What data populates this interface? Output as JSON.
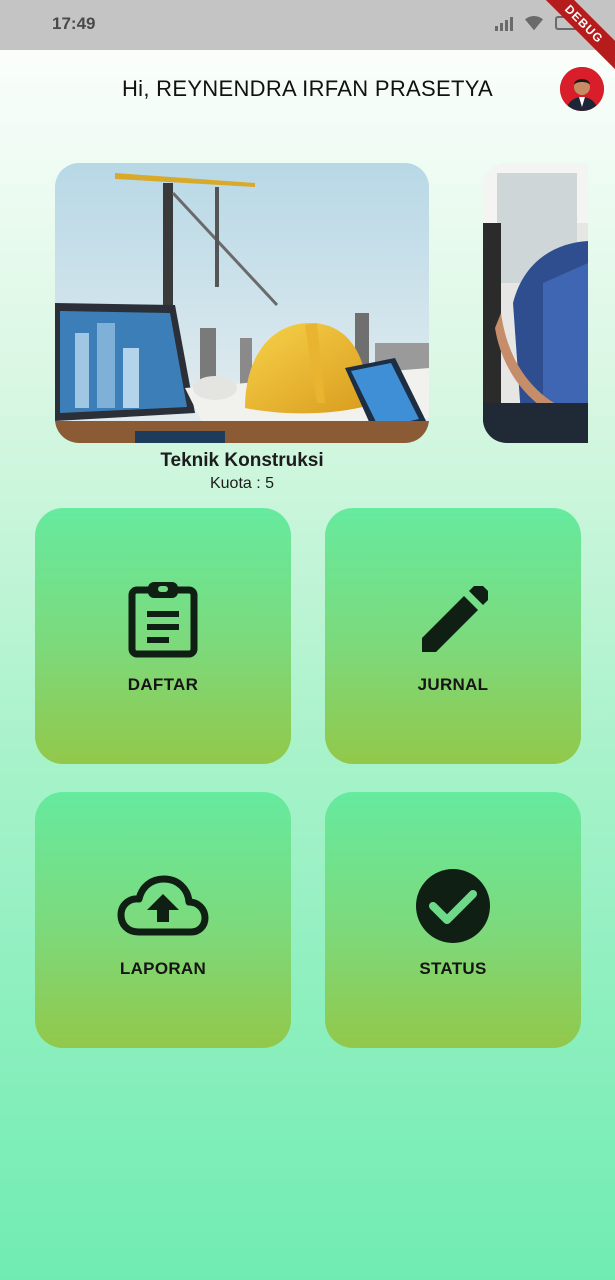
{
  "status_bar": {
    "time": "17:49",
    "debug_label": "DEBUG"
  },
  "header": {
    "greeting": "Hi, REYNENDRA IRFAN PRASETYA"
  },
  "carousel": {
    "items": [
      {
        "title": "Teknik Konstruksi",
        "quota": "Kuota : 5",
        "image": "construction-scene"
      },
      {
        "image": "mechanic-workshop"
      }
    ]
  },
  "menu": {
    "items": [
      {
        "label": "DAFTAR",
        "icon": "clipboard-icon"
      },
      {
        "label": "JURNAL",
        "icon": "pencil-icon"
      },
      {
        "label": "LAPORAN",
        "icon": "cloud-upload-icon"
      },
      {
        "label": "STATUS",
        "icon": "check-circle-icon"
      }
    ]
  },
  "colors": {
    "tile_top": "#66ea9f",
    "tile_bottom": "#92c84a",
    "icon": "#0f1f14",
    "debug_banner": "#b71c1c"
  }
}
